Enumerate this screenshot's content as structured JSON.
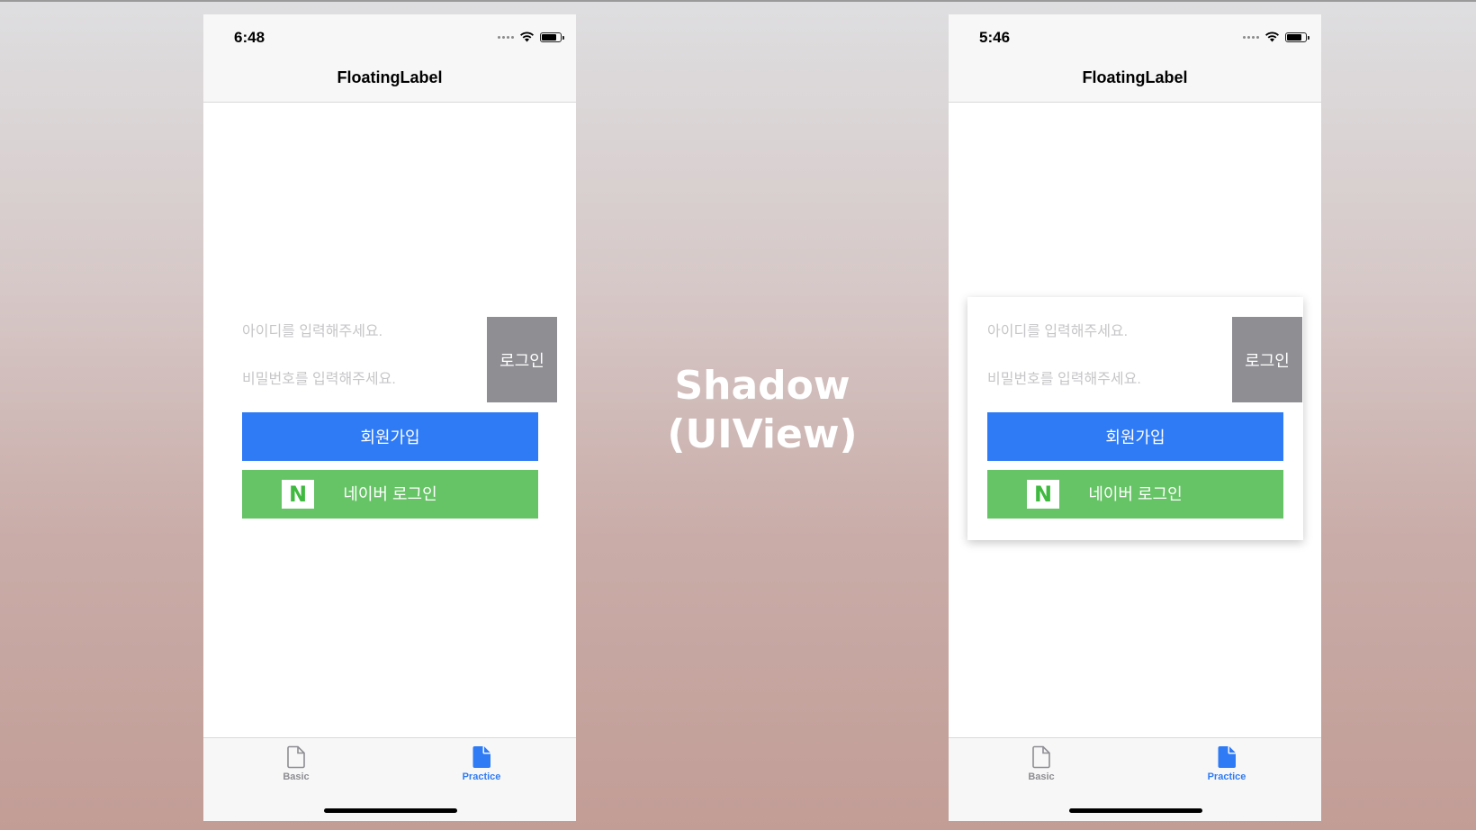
{
  "caption": {
    "line1": "Shadow",
    "line2": "(UIView)"
  },
  "phones": [
    {
      "status_time": "6:48",
      "nav_title": "FloatingLabel",
      "card_shadow": false,
      "id_placeholder": "아이디를 입력해주세요.",
      "pw_placeholder": "비밀번호를 입력해주세요.",
      "login_label": "로그인",
      "signup_label": "회원가입",
      "naver_logo_letter": "N",
      "naver_label": "네이버 로그인",
      "tabs": [
        {
          "label": "Basic",
          "icon": "doc-outline-icon",
          "selected": false
        },
        {
          "label": "Practice",
          "icon": "doc-filled-icon",
          "selected": true
        }
      ]
    },
    {
      "status_time": "5:46",
      "nav_title": "FloatingLabel",
      "card_shadow": true,
      "id_placeholder": "아이디를 입력해주세요.",
      "pw_placeholder": "비밀번호를 입력해주세요.",
      "login_label": "로그인",
      "signup_label": "회원가입",
      "naver_logo_letter": "N",
      "naver_label": "네이버 로그인",
      "tabs": [
        {
          "label": "Basic",
          "icon": "doc-outline-icon",
          "selected": false
        },
        {
          "label": "Practice",
          "icon": "doc-filled-icon",
          "selected": true
        }
      ]
    }
  ],
  "colors": {
    "signup_blue": "#2f7bf5",
    "naver_green": "#66c466",
    "login_gray": "#8e8e93",
    "tab_selected": "#2f7bf5",
    "tab_unselected": "#8e8e93"
  }
}
